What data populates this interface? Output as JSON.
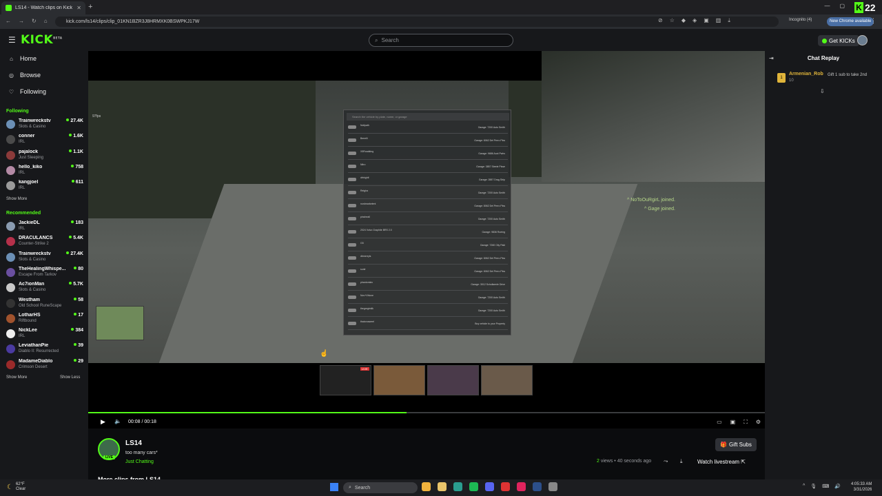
{
  "browser": {
    "tab_title": "LS14 - Watch clips on Kick",
    "url": "kick.com/ls14/clips/clip_01KN1BZR3J8HRMXK0BSWPKJ17W",
    "incognito_label": "Incognito (4)",
    "update_label": "New Chrome available",
    "kick_badge_number": "22"
  },
  "header": {
    "logo": "KICK",
    "logo_sup": "BETA",
    "search_placeholder": "Search",
    "get_kicks_label": "Get KICKs"
  },
  "sidebar": {
    "nav": [
      {
        "label": "Home",
        "icon": "home-icon"
      },
      {
        "label": "Browse",
        "icon": "compass-icon"
      },
      {
        "label": "Following",
        "icon": "heart-icon"
      }
    ],
    "following_heading": "Following",
    "following": [
      {
        "name": "Trainwreckstv",
        "category": "Slots & Casino",
        "viewers": "27.4K",
        "color": "#6b8fb5"
      },
      {
        "name": "conner",
        "category": "IRL",
        "viewers": "1.6K",
        "color": "#4a4a4a"
      },
      {
        "name": "pajalock",
        "category": "Just Sleeping",
        "viewers": "1.1K",
        "color": "#8b3a3a"
      },
      {
        "name": "hello_kiko",
        "category": "IRL",
        "viewers": "758",
        "color": "#b48aa5"
      },
      {
        "name": "kangjoel",
        "category": "IRL",
        "viewers": "611",
        "color": "#9a9a9a"
      }
    ],
    "show_more_following": "Show More",
    "recommended_heading": "Recommended",
    "recommended": [
      {
        "name": "JackieDL",
        "category": "IRL",
        "viewers": "183",
        "color": "#8a9bb0"
      },
      {
        "name": "DRACULANCS",
        "category": "Counter-Strike 2",
        "viewers": "5.4K",
        "color": "#b5304a"
      },
      {
        "name": "Trainwreckstv",
        "category": "Slots & Casino",
        "viewers": "27.4K",
        "color": "#6b8fb5"
      },
      {
        "name": "TheHealingWhispe...",
        "category": "Escape From Tarkov",
        "viewers": "80",
        "color": "#6a4fa0"
      },
      {
        "name": "Ac7ionMan",
        "category": "Slots & Casino",
        "viewers": "5.7K",
        "color": "#c9c9c9"
      },
      {
        "name": "Westham",
        "category": "Old School RuneScape",
        "viewers": "58",
        "color": "#333333"
      },
      {
        "name": "LotharHS",
        "category": "Riftbound",
        "viewers": "17",
        "color": "#a0522d"
      },
      {
        "name": "NickLee",
        "category": "IRL",
        "viewers": "384",
        "color": "#eeeeee"
      },
      {
        "name": "LeviathanPie",
        "category": "Diablo II: Resurrected",
        "viewers": "39",
        "color": "#4a3aa0"
      },
      {
        "name": "MadameDiablo",
        "category": "Crimson Desert",
        "viewers": "29",
        "color": "#9a2a2a"
      }
    ],
    "show_more": "Show More",
    "show_less": "Show Less"
  },
  "player": {
    "fps_text": "97fps",
    "joined_lines": [
      "^ NoToOuRgirL joined.",
      "^ Gage joined."
    ],
    "garage_rows": [
      {
        "left": "Nullpath",
        "right": "Garage: 7200 Auto Smith"
      },
      {
        "left": "Benelli",
        "right": "Garage: 8062 Del Perro Pkw"
      },
      {
        "left": "X5Roadking",
        "right": "Garage: 9686 Auct Pwhs"
      },
      {
        "left": "Nitro",
        "right": "Garage: 3857 Steele Pkwe"
      },
      {
        "left": "drfnightl",
        "right": "Garage: 2887 Drag Strip"
      },
      {
        "left": "Reigha",
        "right": "Garage: 7200 Auto Smith"
      },
      {
        "left": "nordmarkelent",
        "right": "Garage: 8062 Del Perro Pkw"
      },
      {
        "left": "pincheall",
        "right": "Garage: 7200 Auto Smith"
      },
      {
        "left": "2024 Volvo Graphite BRS 2.0",
        "right": "Garage: 9836 Roeing"
      },
      {
        "left": "G5",
        "right": "Garage: 7260 City Pakl"
      },
      {
        "left": "dbmerryls",
        "right": "Garage: 8062 Del Perro Pkw"
      },
      {
        "left": "sunlr",
        "right": "Garage: 8062 Del Perro Pkw"
      },
      {
        "left": "phantomlec",
        "right": "Garage: 3012 Schollaenle Drive"
      },
      {
        "left": "Nov+Vhlove",
        "right": "Garage: 7200 Auto Smith"
      },
      {
        "left": "thegregimilk",
        "right": "Garage: 7200 Auto Smith"
      },
      {
        "left": "thatcrosserel",
        "right": "Buy vehicle to your Property"
      }
    ],
    "garage_search": "Search the vehicle by plate, name, or garage",
    "thumb_live_label": "LIVE",
    "progress_fraction": 0.47,
    "time_current": "00:08",
    "time_separator": "/",
    "time_total": "00:18"
  },
  "info": {
    "streamer": "LS14",
    "title": "too many cars*",
    "category": "Just Chatting",
    "live_badge": "LIVE",
    "gift_subs": "Gift Subs",
    "views_count": "2",
    "views_text": "views • 40 seconds ago",
    "watch_livestream": "Watch livestream",
    "more_clips": "More clips from LS14"
  },
  "chat": {
    "title": "Chat Replay",
    "message": {
      "badge": "1",
      "user": "Armenian_Rob",
      "count": "10",
      "gift_text": "Gift 1 sub to take 2nd"
    }
  },
  "taskbar": {
    "temp": "62°F",
    "weather": "Clear",
    "search": "Search",
    "time": "4:05:33 AM",
    "date": "3/31/2026",
    "app_colors": [
      "#f2b33d",
      "#e9c46a",
      "#2a9d8f",
      "#1db954",
      "#5865f2",
      "#d33",
      "#e0245e",
      "#2c4f8a",
      "#888888"
    ]
  }
}
